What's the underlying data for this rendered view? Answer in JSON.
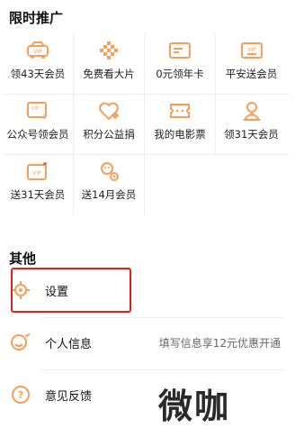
{
  "promo": {
    "title": "限时推广",
    "items": [
      {
        "label": "领43天会员",
        "icon": "vip-car-icon"
      },
      {
        "label": "免费看大片",
        "icon": "diamond-dots-icon"
      },
      {
        "label": "0元领年卡",
        "icon": "card-icon"
      },
      {
        "label": "平安送会员",
        "icon": "vip-ticket-icon"
      },
      {
        "label": "公众号领会员",
        "icon": "vip-31-icon"
      },
      {
        "label": "积分公益捐",
        "icon": "heart-points-icon"
      },
      {
        "label": "我的电影票",
        "icon": "movie-ticket-icon"
      },
      {
        "label": "领31天会员",
        "icon": "gift-doll-icon"
      },
      {
        "label": "送31天会员",
        "icon": "vip-heart-icon"
      },
      {
        "label": "送14月会员",
        "icon": "monkey-icon"
      }
    ]
  },
  "other": {
    "title": "其他",
    "settings_label": "设置",
    "profile_label": "个人信息",
    "profile_hint": "填写信息享12元优惠开通",
    "feedback_label": "意见反馈"
  },
  "watermark": "微咖",
  "colors": {
    "accent": "#f5a05a",
    "highlight": "#e02020"
  }
}
